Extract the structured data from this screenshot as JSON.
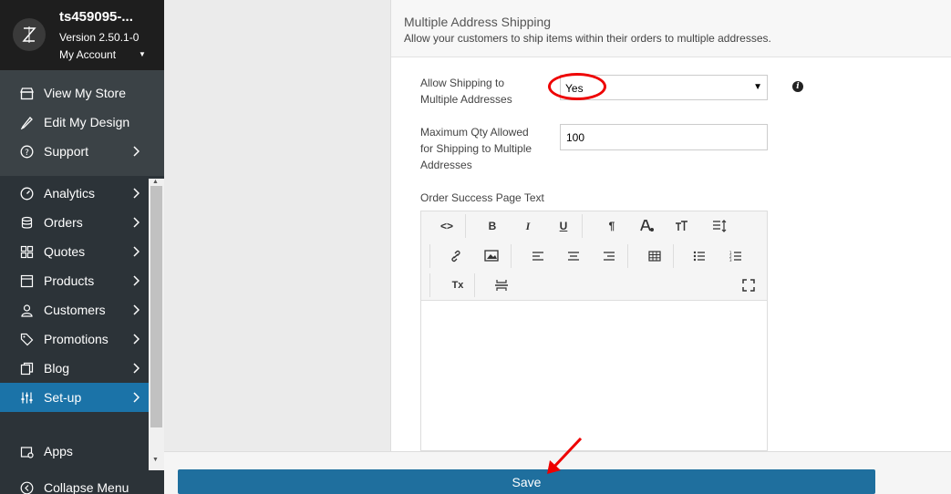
{
  "sidebar": {
    "store_name": "ts459095-...",
    "version": "Version 2.50.1-0",
    "account": "My Account",
    "top_items": [
      {
        "label": "View My Store",
        "icon": "store-icon"
      },
      {
        "label": "Edit My Design",
        "icon": "pencil-icon"
      },
      {
        "label": "Support",
        "icon": "question-icon"
      }
    ],
    "items": [
      {
        "label": "Analytics",
        "icon": "gauge-icon"
      },
      {
        "label": "Orders",
        "icon": "database-icon"
      },
      {
        "label": "Quotes",
        "icon": "grid-icon"
      },
      {
        "label": "Products",
        "icon": "box-icon"
      },
      {
        "label": "Customers",
        "icon": "user-icon"
      },
      {
        "label": "Promotions",
        "icon": "tag-icon"
      },
      {
        "label": "Blog",
        "icon": "copy-icon"
      },
      {
        "label": "Set-up",
        "icon": "sliders-icon",
        "active": true
      }
    ],
    "apps": "Apps",
    "collapse": "Collapse Menu"
  },
  "section": {
    "title": "Multiple Address Shipping",
    "description": "Allow your customers to ship items within their orders to multiple addresses."
  },
  "form": {
    "allow_label_1": "Allow Shipping to",
    "allow_label_2": "Multiple Addresses",
    "allow_value": "Yes",
    "qty_label_1": "Maximum Qty Allowed",
    "qty_label_2": "for Shipping to Multiple",
    "qty_label_3": "Addresses",
    "qty_value": "100",
    "order_text_label": "Order Success Page Text"
  },
  "editor": {
    "buttons": {
      "code": "<>",
      "bold": "B",
      "italic": "I",
      "underline": "U",
      "paragraph": "¶",
      "clear": "Tx"
    }
  },
  "footer": {
    "save_label": "Save"
  },
  "colors": {
    "accent": "#1f6f9e",
    "active_nav": "#1b73a8",
    "annotation": "#e00000"
  }
}
